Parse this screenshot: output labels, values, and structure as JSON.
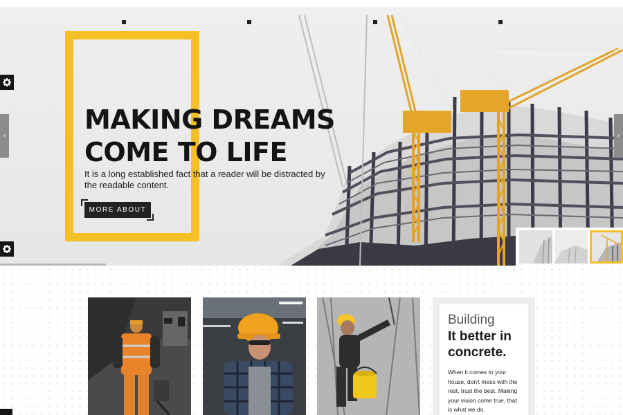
{
  "hero": {
    "title_line1": "MAKING DREAMS",
    "title_line2": "COME TO LIFE",
    "subtitle": "It is a long established fact that a reader will be distracted by the readable content.",
    "button_label": "MORE ABOUT",
    "prev_arrow": "‹",
    "next_arrow": "›",
    "gear_icon": "gear-icon",
    "accent_color": "#f4c024"
  },
  "text_card": {
    "heading_light": "Building",
    "heading_bold": "It better in concrete.",
    "body": "When it comes to your house, don't mess with the rest, trust the best. Making your vision come true, that is what we do."
  },
  "colors": {
    "accent": "#f4c024",
    "dark": "#141414"
  }
}
